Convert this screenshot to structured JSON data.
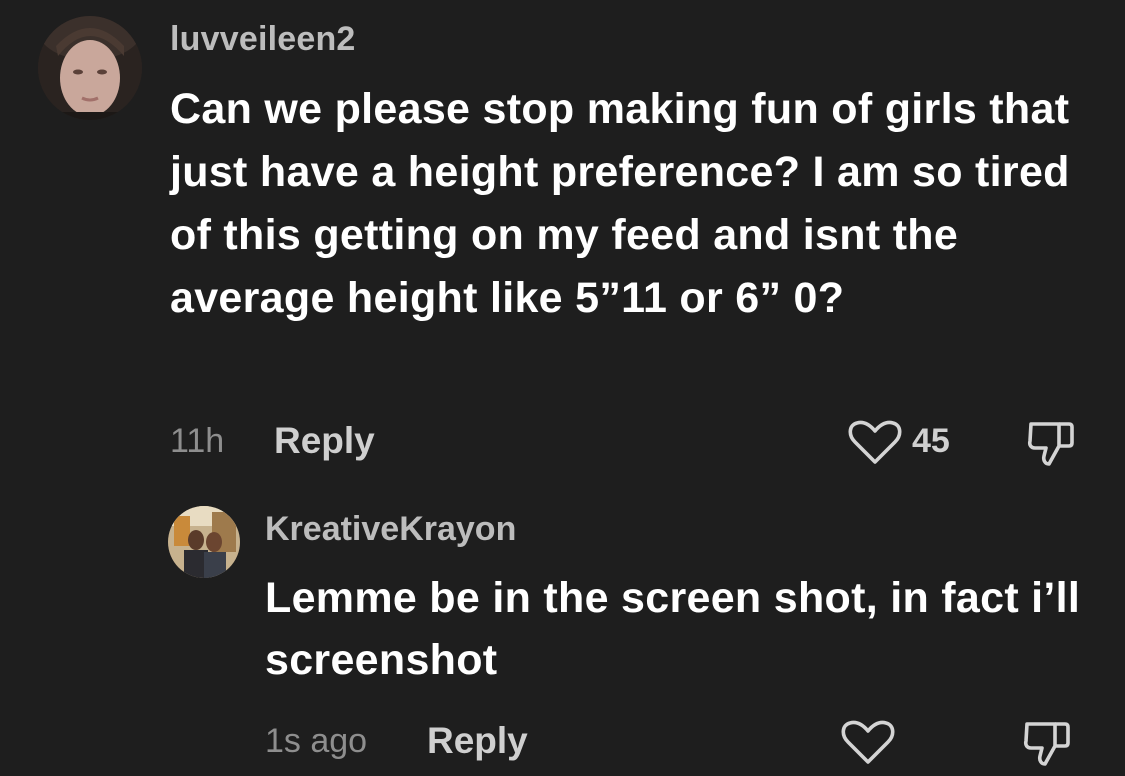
{
  "comments": [
    {
      "username": "luvveileen2",
      "text": "Can we please stop making fun of girls that just have a height preference? I am so tired of this getting on my feed and isnt the average height like 5”11 or 6” 0?",
      "time": "11h",
      "reply_label": "Reply",
      "like_count": "45",
      "avatar_icon": "profile-photo",
      "like_icon": "heart-outline-icon",
      "dislike_icon": "thumbs-down-outline-icon"
    },
    {
      "username": "KreativeKrayon",
      "text": "Lemme be in the screen shot, in fact i’ll screenshot",
      "time": "1s ago",
      "reply_label": "Reply",
      "avatar_icon": "profile-photo",
      "like_icon": "heart-outline-icon",
      "dislike_icon": "thumbs-down-outline-icon"
    }
  ],
  "colors": {
    "background": "#1e1e1e",
    "text_primary": "#ffffff",
    "username": "#bdbdbd",
    "meta": "#8e8e8e"
  }
}
